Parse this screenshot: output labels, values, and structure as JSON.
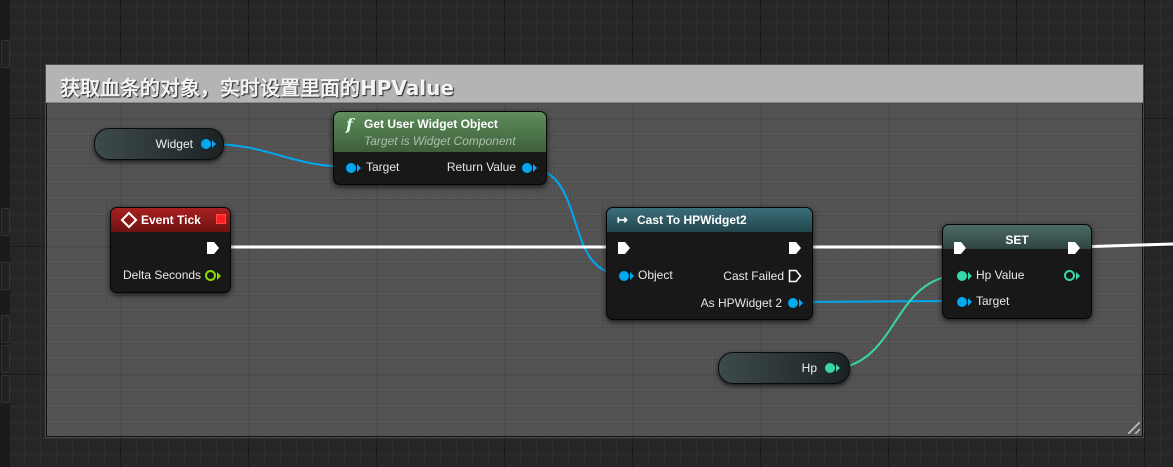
{
  "comment": {
    "title": "获取血条的对象，实时设置里面的HPValue",
    "header_color": "#b4b4b4"
  },
  "colors": {
    "object_pin": "#00a8f2",
    "float_pin": "#38d6a8",
    "bool_pin": "#8bdc00",
    "exec": "#ffffff",
    "event_header": "#8e1818",
    "function_header": "#4e7a4e",
    "cast_header": "#2f5c66",
    "set_header": "#3e5552"
  },
  "nodes": {
    "widget_var": {
      "label": "Widget",
      "icon": "object-pin-icon"
    },
    "get_user_widget": {
      "icon": "function-icon",
      "icon_glyph": "f",
      "title": "Get User Widget Object",
      "subtitle": "Target is Widget Component",
      "input_target": "Target",
      "output_return": "Return Value"
    },
    "event_tick": {
      "icon": "event-diamond-icon",
      "title": "Event Tick",
      "output_delta": "Delta Seconds"
    },
    "cast": {
      "icon": "cast-arrow-icon",
      "icon_glyph": "↦",
      "title": "Cast To HPWidget2",
      "input_object": "Object",
      "output_failed": "Cast Failed",
      "output_as": "As HPWidget 2"
    },
    "set": {
      "title": "SET",
      "input_value": "Hp Value",
      "input_target": "Target"
    },
    "hp_var": {
      "label": "Hp",
      "icon": "float-pin-icon"
    }
  }
}
